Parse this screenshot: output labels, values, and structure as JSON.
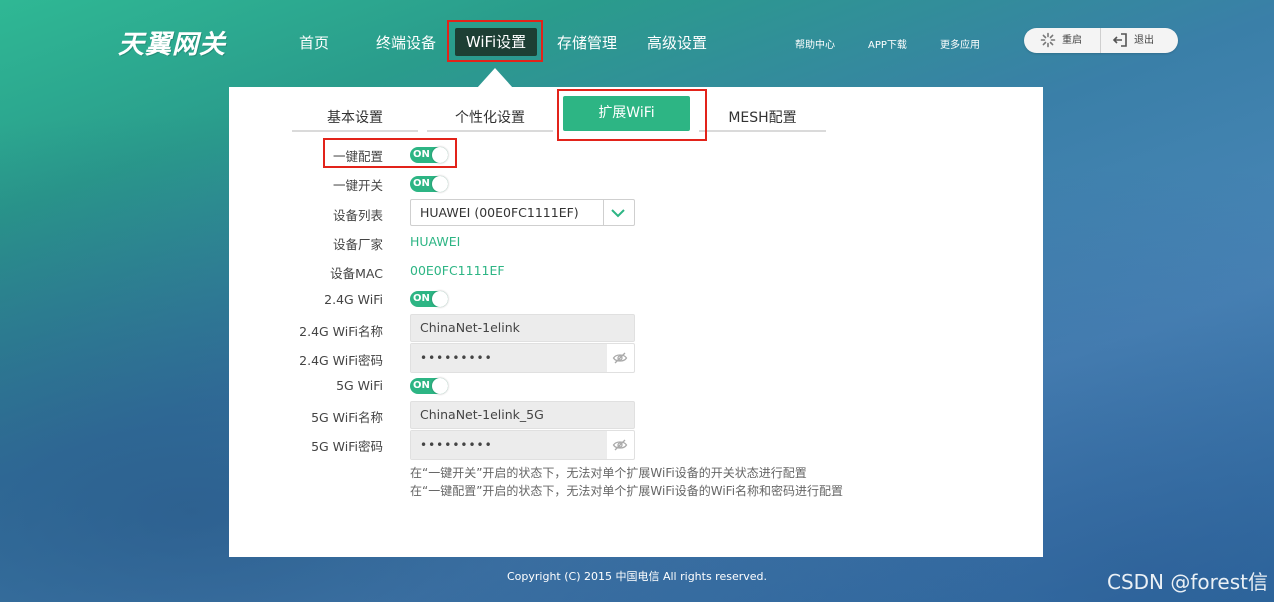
{
  "brand": {
    "logo": "天翼网关"
  },
  "nav": {
    "items": [
      {
        "label": "首页"
      },
      {
        "label": "终端设备"
      },
      {
        "label": "WiFi设置"
      },
      {
        "label": "存储管理"
      },
      {
        "label": "高级设置"
      }
    ],
    "active": "WiFi设置"
  },
  "utility": {
    "help": "帮助中心",
    "app": "APP下载",
    "more": "更多应用",
    "reboot": "重启",
    "logout": "退出"
  },
  "tabs": [
    {
      "label": "基本设置"
    },
    {
      "label": "个性化设置"
    },
    {
      "label": "扩展WiFi"
    },
    {
      "label": "MESH配置"
    }
  ],
  "form": {
    "one_key_config": {
      "label": "一键配置",
      "state": "ON"
    },
    "one_key_switch": {
      "label": "一键开关",
      "state": "ON"
    },
    "device_list": {
      "label": "设备列表",
      "value": "HUAWEI (00E0FC1111EF)"
    },
    "vendor": {
      "label": "设备厂家",
      "value": "HUAWEI"
    },
    "mac": {
      "label": "设备MAC",
      "value": "00E0FC1111EF"
    },
    "wifi24": {
      "label": "2.4G WiFi",
      "state": "ON"
    },
    "wifi24_name": {
      "label": "2.4G WiFi名称",
      "value": "ChinaNet-1elink"
    },
    "wifi24_pwd": {
      "label": "2.4G WiFi密码",
      "value": "•••••••••"
    },
    "wifi5": {
      "label": "5G WiFi",
      "state": "ON"
    },
    "wifi5_name": {
      "label": "5G WiFi名称",
      "value": "ChinaNet-1elink_5G"
    },
    "wifi5_pwd": {
      "label": "5G WiFi密码",
      "value": "•••••••••"
    }
  },
  "notes": [
    "在“一键开关”开启的状态下，无法对单个扩展WiFi设备的开关状态进行配置",
    "在“一键配置”开启的状态下，无法对单个扩展WiFi设备的WiFi名称和密码进行配置"
  ],
  "footer": {
    "copyright": "Copyright (C) 2015 中国电信 All rights reserved."
  },
  "watermark": "CSDN @forest信",
  "colors": {
    "accent": "#2db584",
    "nav_active": "#1d3f34",
    "highlight": "#e2231a"
  }
}
